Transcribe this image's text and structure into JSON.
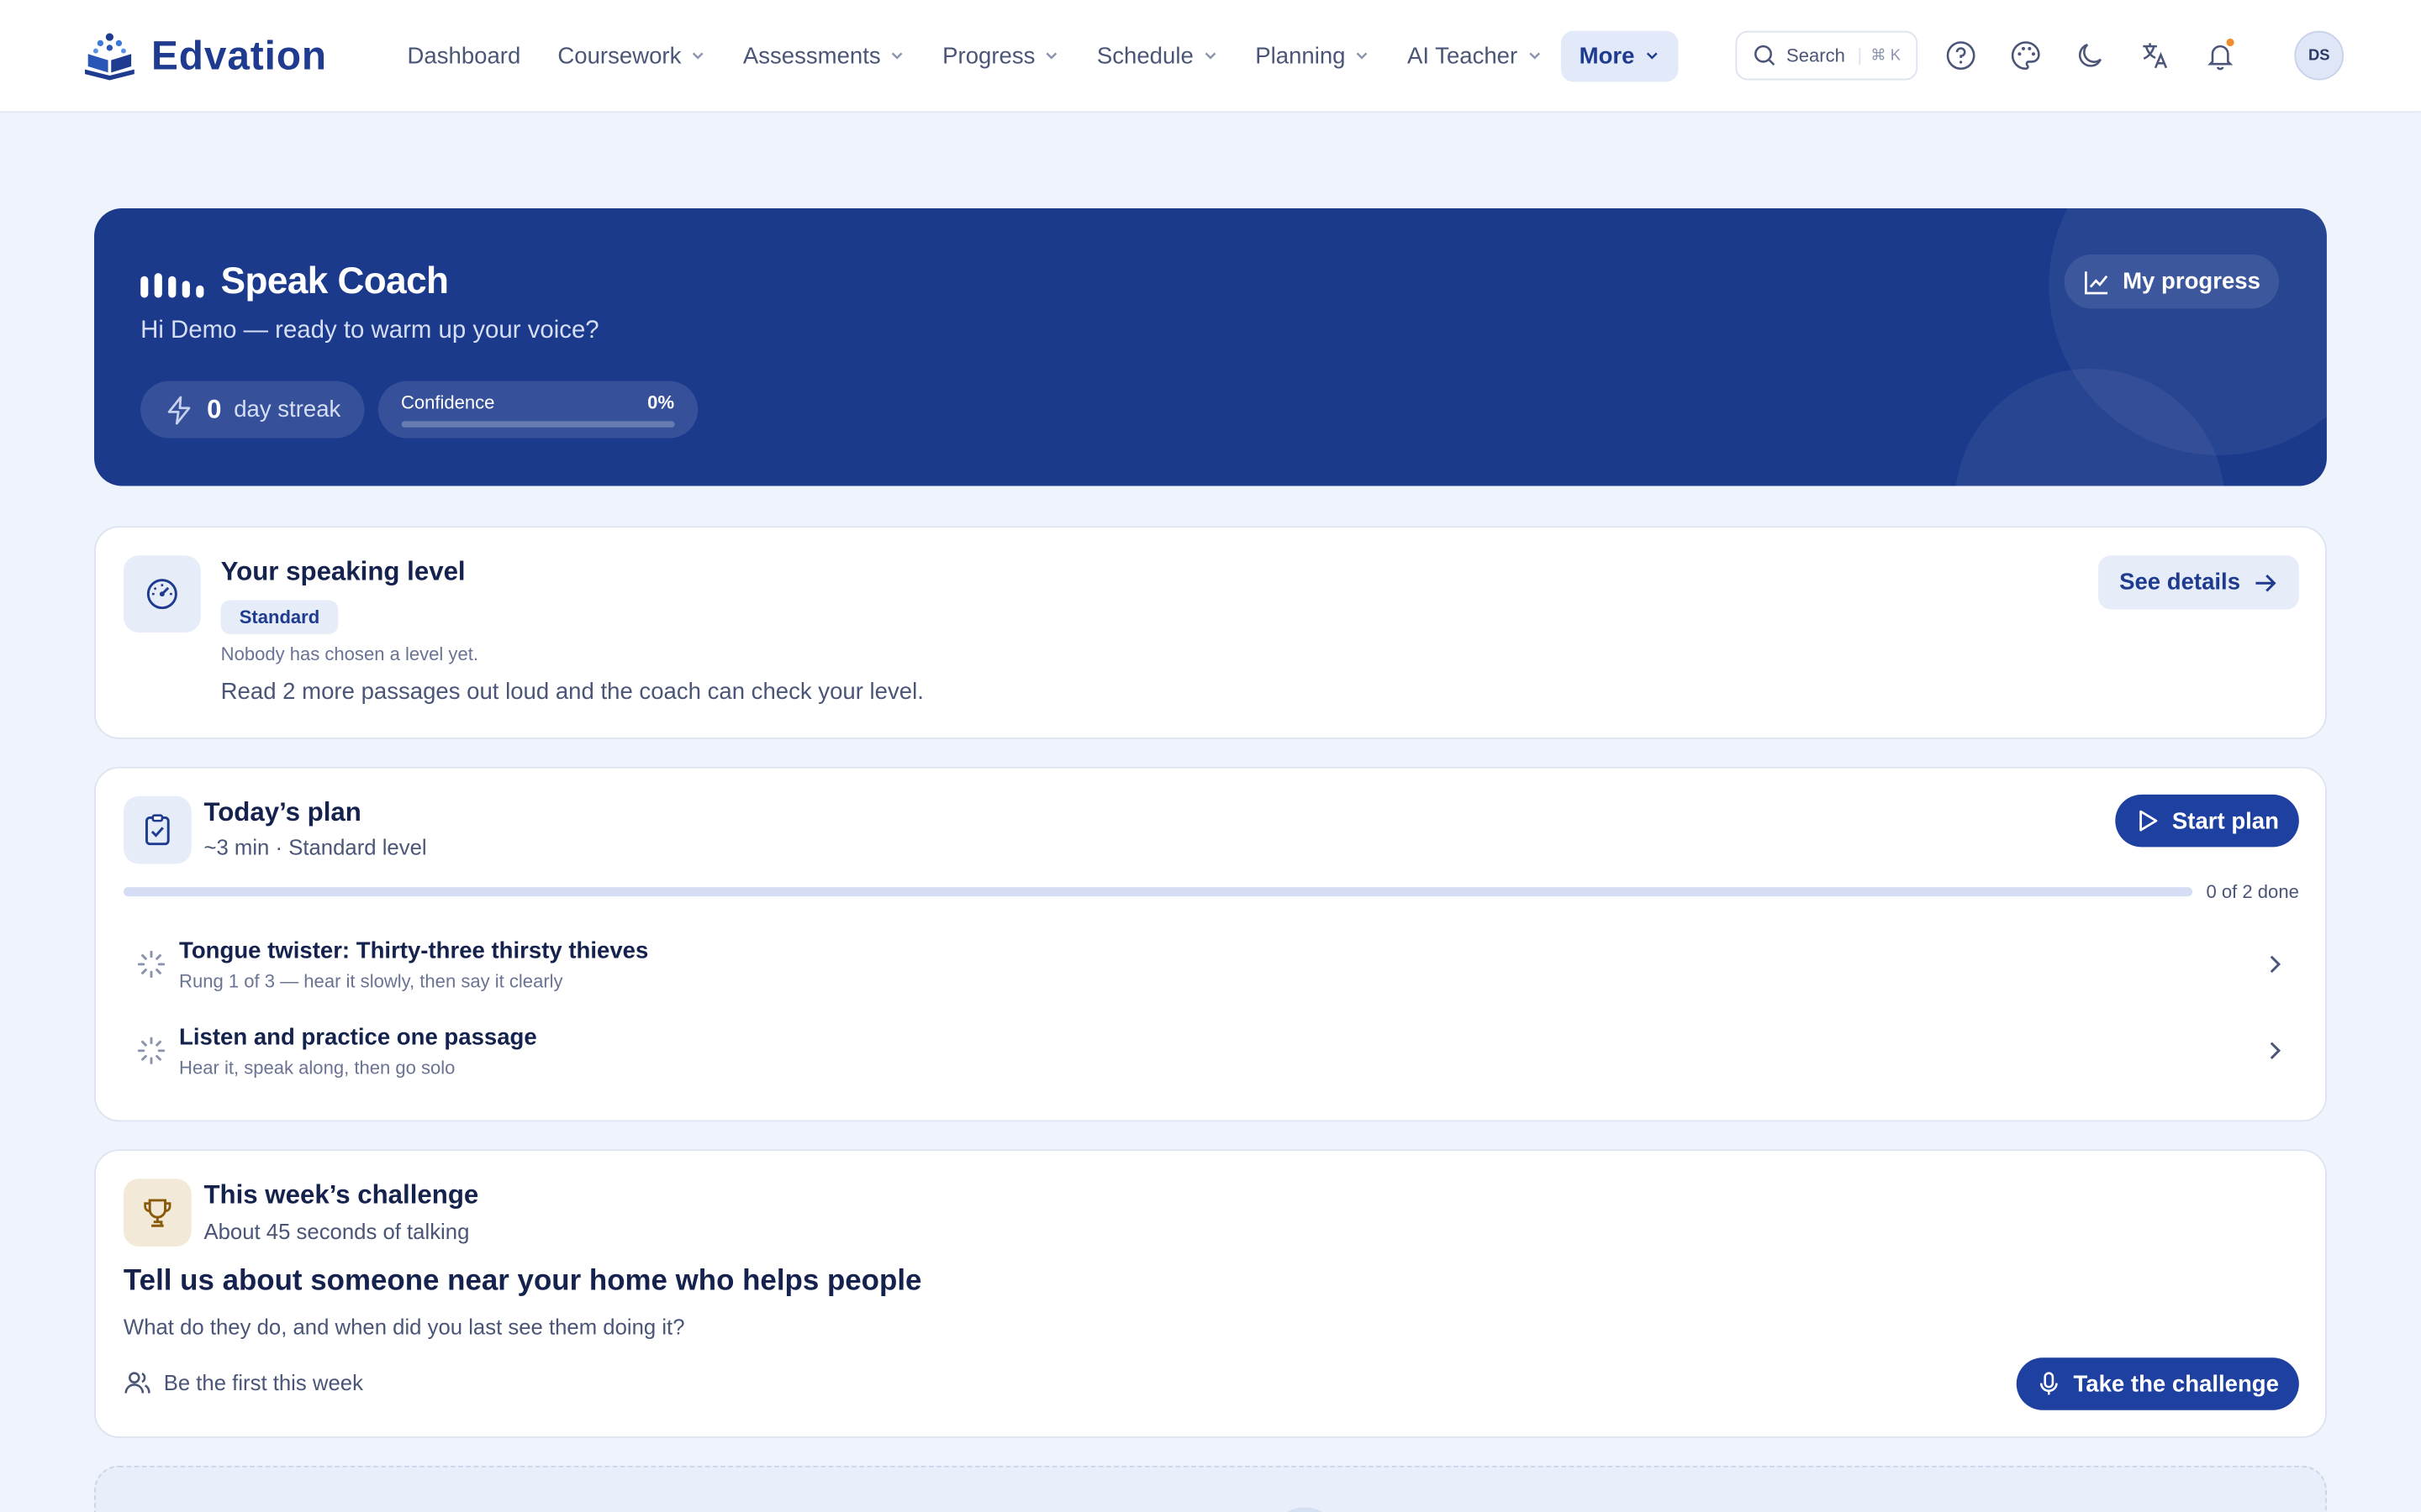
{
  "app": {
    "name": "Edvation"
  },
  "nav": {
    "items": [
      {
        "label": "Dashboard",
        "dropdown": false
      },
      {
        "label": "Coursework",
        "dropdown": true
      },
      {
        "label": "Assessments",
        "dropdown": true
      },
      {
        "label": "Progress",
        "dropdown": true
      },
      {
        "label": "Schedule",
        "dropdown": true
      },
      {
        "label": "Planning",
        "dropdown": true
      },
      {
        "label": "AI Teacher",
        "dropdown": true
      },
      {
        "label": "More",
        "dropdown": true,
        "active": true
      }
    ],
    "search_placeholder": "Search",
    "search_shortcut": "⌘ K",
    "avatar_initials": "DS"
  },
  "hero": {
    "title": "Speak Coach",
    "greeting": "Hi Demo — ready to warm up your voice?",
    "streak_count": "0",
    "streak_label": "day streak",
    "confidence_label": "Confidence",
    "confidence_value": "0%",
    "confidence_fraction": 0,
    "progress_button": "My progress"
  },
  "level": {
    "title": "Your speaking level",
    "badge": "Standard",
    "note": "Nobody has chosen a level yet.",
    "description": "Read 2 more passages out loud and the coach can check your level.",
    "details_button": "See details"
  },
  "plan": {
    "title": "Today’s plan",
    "subtitle": "~3 min · Standard level",
    "start_button": "Start plan",
    "count": "0 of 2 done",
    "progress_fraction": 0,
    "tasks": [
      {
        "title": "Tongue twister: Thirty-three thirsty thieves",
        "desc": "Rung 1 of 3 — hear it slowly, then say it clearly"
      },
      {
        "title": "Listen and practice one passage",
        "desc": "Hear it, speak along, then go solo"
      }
    ]
  },
  "challenge": {
    "title": "This week’s challenge",
    "subtitle": "About 45 seconds of talking",
    "question": "Tell us about someone near your home who helps people",
    "hint": "What do they do, and when did you last see them doing it?",
    "first_label": "Be the first this week",
    "button": "Take the challenge"
  },
  "colors": {
    "brand": "#1e3b8f",
    "hero_bg": "#1b3a8c",
    "primary_button": "#1e40a0",
    "notification_dot": "#f08c2a"
  }
}
